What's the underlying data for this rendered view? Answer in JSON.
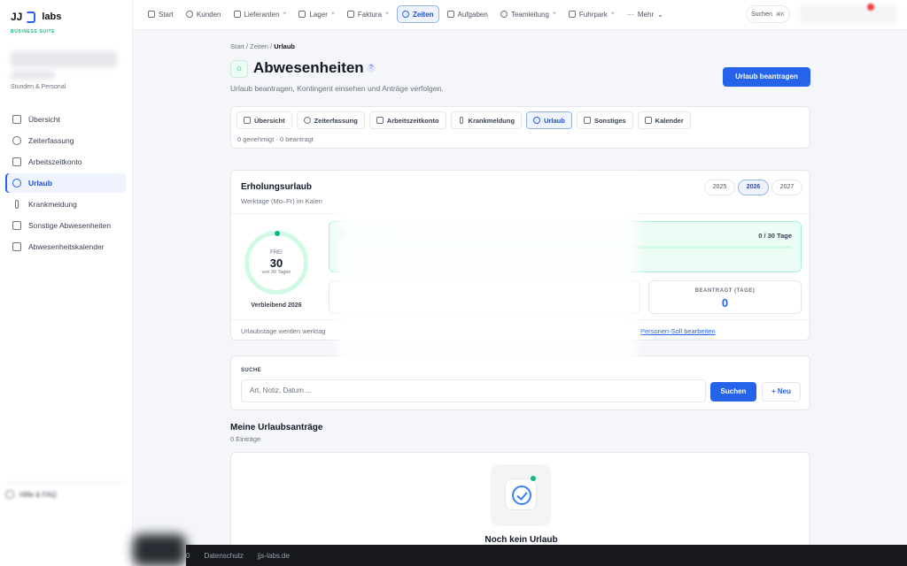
{
  "brand": {
    "name": "labs",
    "mark": "JJ",
    "tagline": "BUSINESS SUITE"
  },
  "sidebar": {
    "module_subtitle": "Stunden & Personal",
    "items": [
      {
        "label": "Übersicht",
        "icon": "grid-icon",
        "active": false
      },
      {
        "label": "Zeiterfassung",
        "icon": "clock-icon",
        "active": false
      },
      {
        "label": "Arbeitszeitkonto",
        "icon": "ledger-icon",
        "active": false
      },
      {
        "label": "Urlaub",
        "icon": "sun-icon",
        "active": true
      },
      {
        "label": "Krankmeldung",
        "icon": "thermometer-icon",
        "active": false
      },
      {
        "label": "Sonstige Abwesenheiten",
        "icon": "document-icon",
        "active": false
      },
      {
        "label": "Abwesenheitskalender",
        "icon": "calendar-icon",
        "active": false
      }
    ],
    "footer_label": "Hilfe & FAQ"
  },
  "topnav": {
    "items": [
      {
        "label": "Start",
        "icon": "home-icon",
        "active": false,
        "pinned": false
      },
      {
        "label": "Kunden",
        "icon": "users-icon",
        "active": false,
        "pinned": false
      },
      {
        "label": "Lieferanten",
        "icon": "truck-icon",
        "active": false,
        "pinned": true
      },
      {
        "label": "Lager",
        "icon": "box-icon",
        "active": false,
        "pinned": true
      },
      {
        "label": "Faktura",
        "icon": "invoice-icon",
        "active": false,
        "pinned": true
      },
      {
        "label": "Zeiten",
        "icon": "clock-icon",
        "active": true,
        "pinned": false
      },
      {
        "label": "Aufgaben",
        "icon": "clipboard-icon",
        "active": false,
        "pinned": false
      },
      {
        "label": "Teamleitung",
        "icon": "team-icon",
        "active": false,
        "pinned": true
      },
      {
        "label": "Fuhrpark",
        "icon": "car-icon",
        "active": false,
        "pinned": true
      },
      {
        "label": "Mehr",
        "icon": "more-icon",
        "active": false,
        "pinned": false
      }
    ],
    "search_label": "Suchen",
    "search_shortcut": "⌘K"
  },
  "page": {
    "breadcrumb": [
      "Start",
      "Zeiten",
      "Urlaub"
    ],
    "title": "Abwesenheiten",
    "subtitle": "Urlaub beantragen, Kontingent einsehen und Anträge verfolgen.",
    "primary_action": "Urlaub beantragen"
  },
  "tabs": {
    "items": [
      {
        "label": "Übersicht",
        "icon": "grid-icon",
        "active": false
      },
      {
        "label": "Zeiterfassung",
        "icon": "clock-icon",
        "active": false
      },
      {
        "label": "Arbeitszeitkonto",
        "icon": "ledger-icon",
        "active": false
      },
      {
        "label": "Krankmeldung",
        "icon": "thermometer-icon",
        "active": false
      },
      {
        "label": "Urlaub",
        "icon": "sun-icon",
        "active": true
      },
      {
        "label": "Sonstiges",
        "icon": "document-icon",
        "active": false
      },
      {
        "label": "Kalender",
        "icon": "calendar-icon",
        "active": false
      }
    ],
    "status": "0 genehmigt · 0 beantragt"
  },
  "vacation": {
    "title": "Erholungsurlaub",
    "subtitle": "Werktage (Mo–Fr) im Kalen",
    "years": [
      {
        "label": "2025",
        "active": false
      },
      {
        "label": "2026",
        "active": true
      },
      {
        "label": "2027",
        "active": false
      }
    ],
    "ring": {
      "label": "FREI",
      "value": "30",
      "caption": "von 30 Tagen",
      "fraction": 1.0
    },
    "remaining_label": "Verbleibend 2026",
    "progress_text": "0 / 30 Tage",
    "progress_fraction": 0.0,
    "stat": {
      "label": "BEANTRAGT (TAGE)",
      "value": "0"
    },
    "footer_text": "Urlaubstage werden werktag",
    "footer_link": "Personen-Soll bearbeiten"
  },
  "search": {
    "label": "SUCHE",
    "placeholder": "Art, Notiz, Datum ...",
    "button": "Suchen",
    "new_button": "+ Neu"
  },
  "requests": {
    "title": "Meine Urlaubsanträge",
    "count": "0 Einträge",
    "empty_title": "Noch kein Urlaub"
  },
  "footer": {
    "links": [
      "Datenschutz",
      "jjs-labs.de"
    ],
    "prefix": "0"
  },
  "colors": {
    "accent": "#2563eb",
    "success": "#10b981",
    "active_bg": "#eef3fd"
  }
}
